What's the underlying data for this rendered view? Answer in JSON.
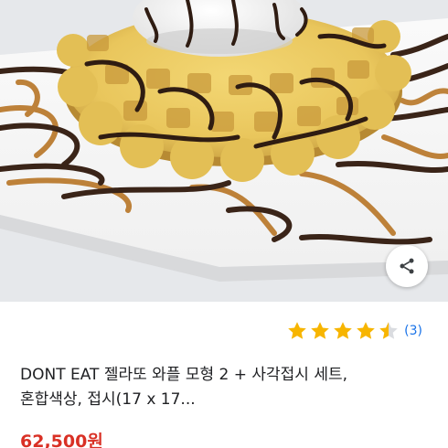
{
  "product": {
    "title_line1": "DONT EAT 젤라또 와플 모형 2 + 사각접시 세트,",
    "title_line2": "혼합색상, 접시(17 x 17...",
    "price": "62,500원",
    "rating_value": 4.5,
    "rating_max": 5,
    "review_count": "(3)"
  },
  "icons": {
    "share": "share-icon",
    "star": "star-icon"
  },
  "colors": {
    "star": "#f7b500",
    "star_empty": "#dadce0",
    "review_count": "#1a73e8",
    "price": "#d93025",
    "title": "#202124"
  }
}
